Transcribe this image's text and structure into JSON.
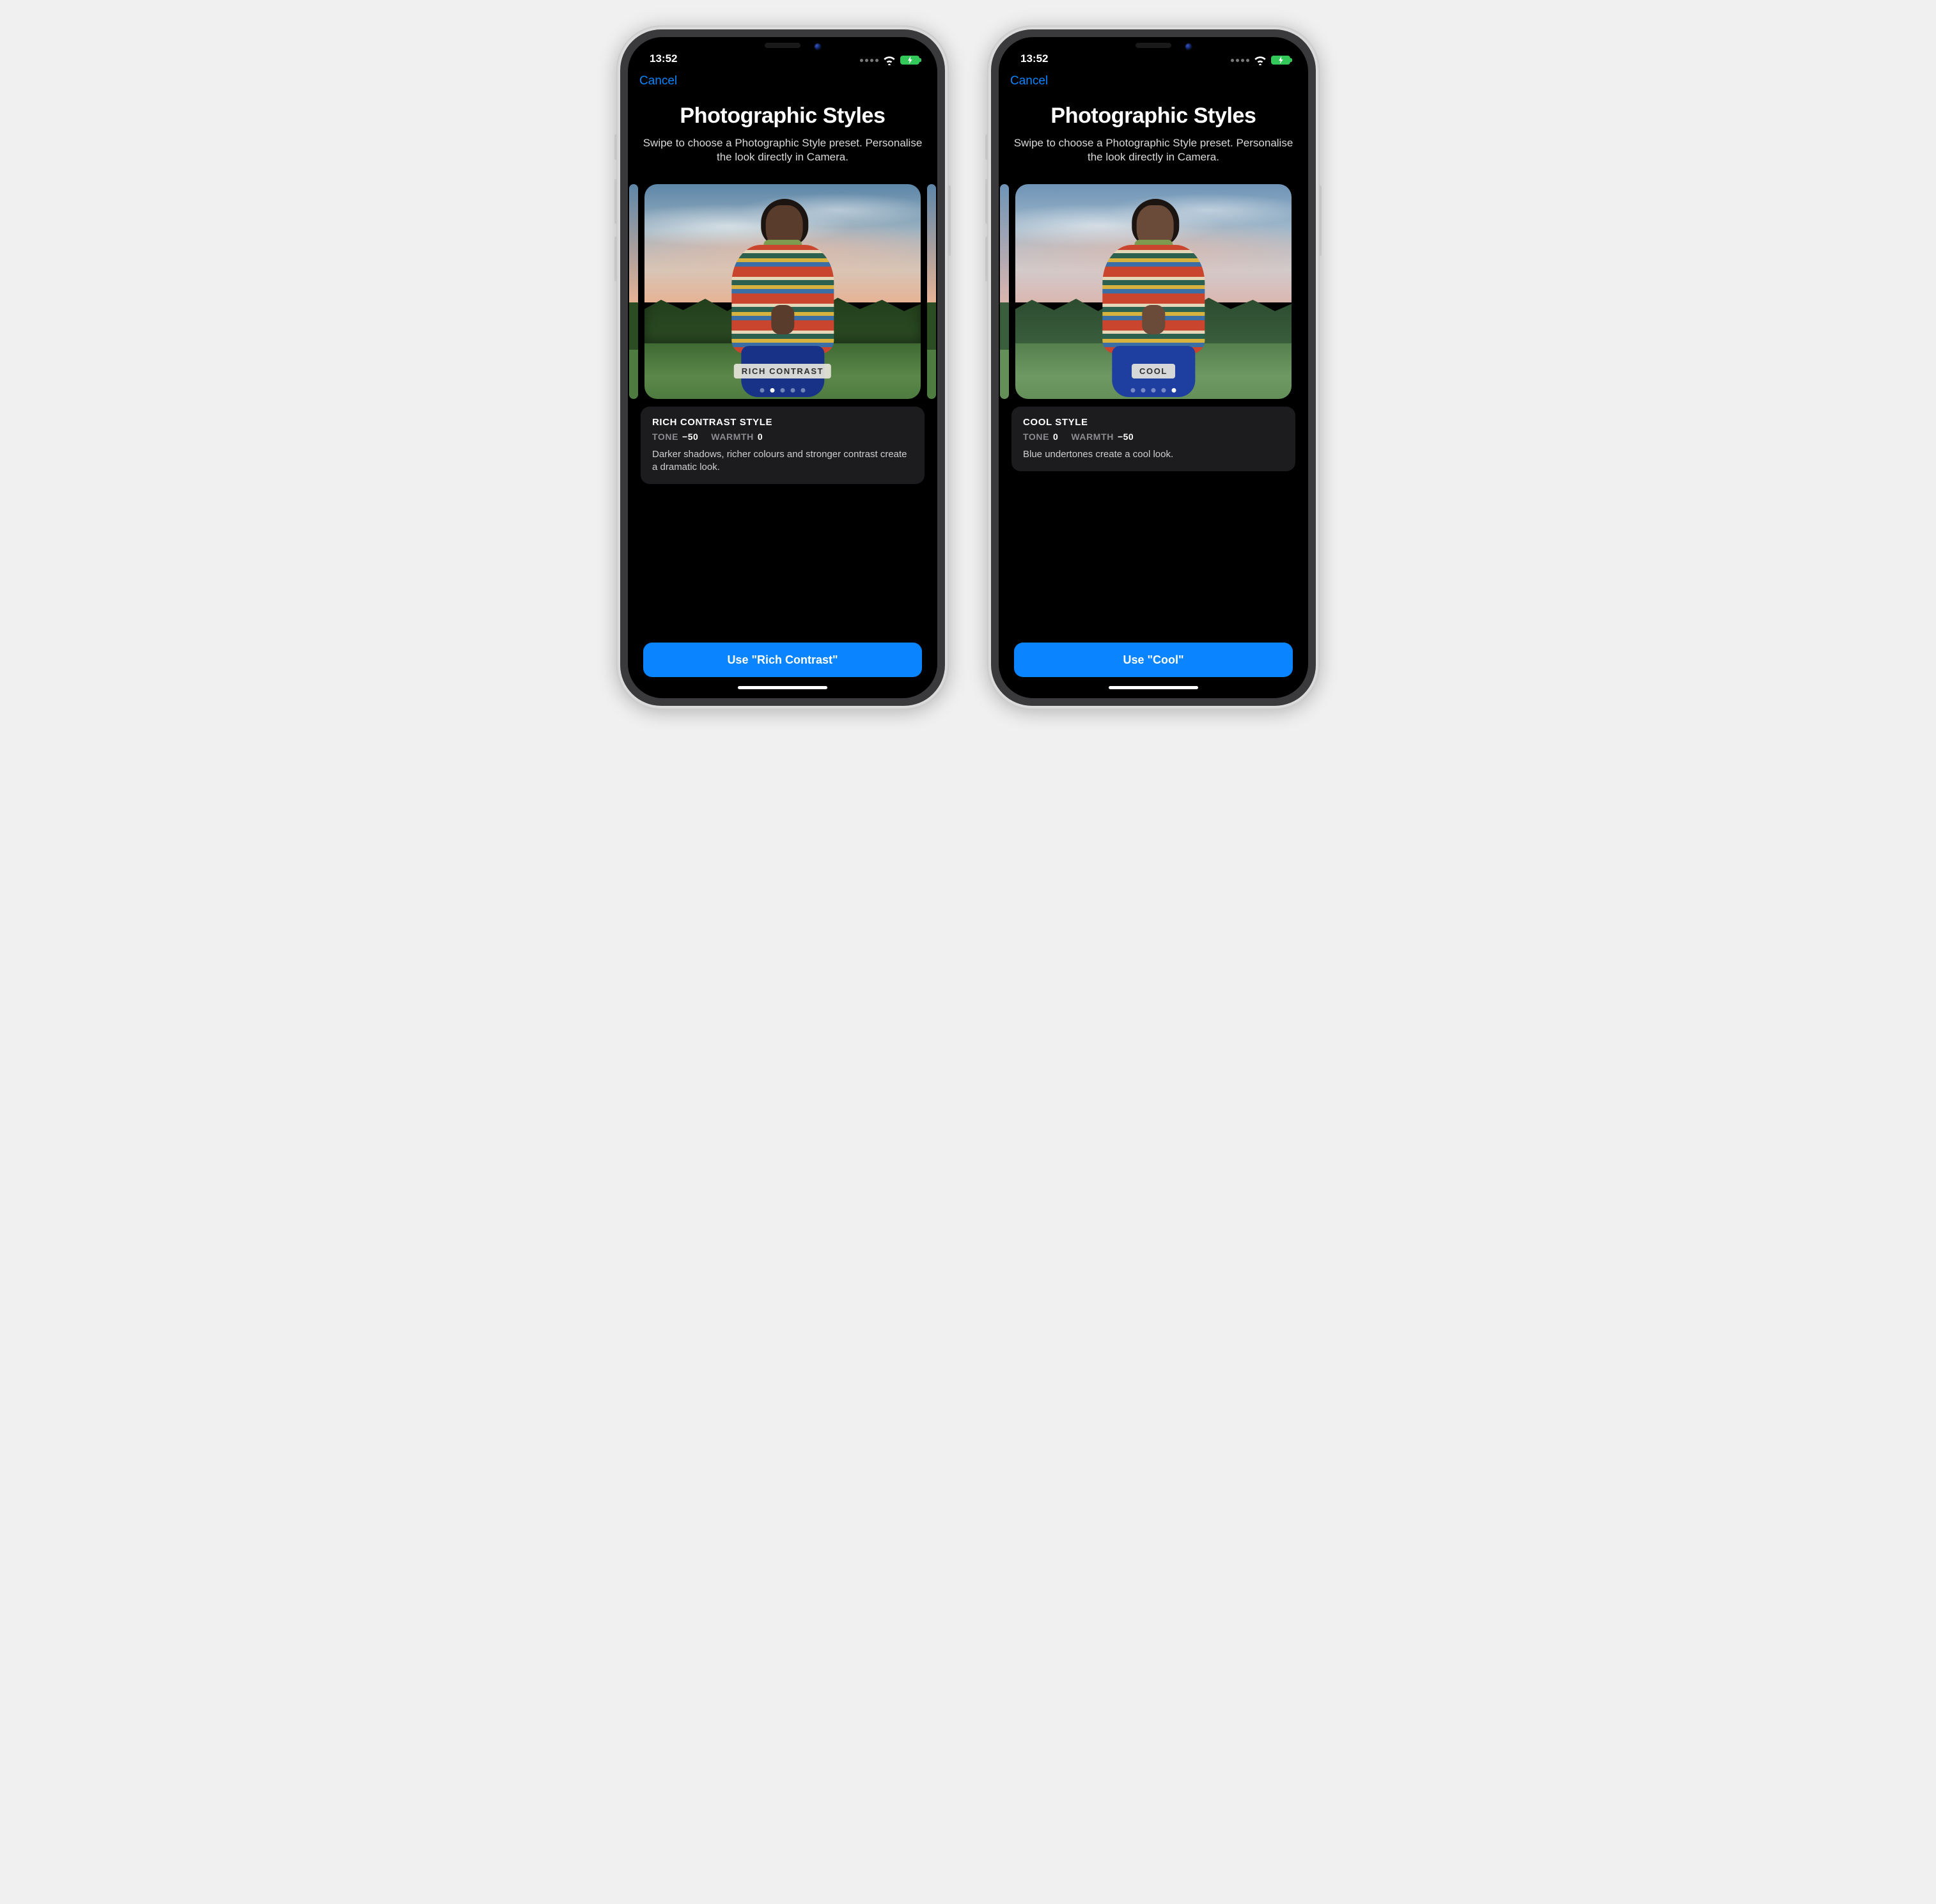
{
  "status": {
    "time": "13:52"
  },
  "nav": {
    "cancel": "Cancel"
  },
  "heading": {
    "title": "Photographic Styles",
    "subtitle": "Swipe to choose a Photographic Style preset. Personalise the look directly in Camera."
  },
  "phones": [
    {
      "badge": "RICH CONTRAST",
      "page_count": 5,
      "page_index": 1,
      "has_right_sliver": true,
      "card": {
        "title": "RICH CONTRAST STYLE",
        "tone_label": "TONE",
        "tone_value": "−50",
        "warmth_label": "WARMTH",
        "warmth_value": "0",
        "description": "Darker shadows, richer colours and stronger contrast create a dramatic look."
      },
      "button": "Use \"Rich Contrast\""
    },
    {
      "badge": "COOL",
      "page_count": 5,
      "page_index": 4,
      "has_right_sliver": false,
      "card": {
        "title": "COOL STYLE",
        "tone_label": "TONE",
        "tone_value": "0",
        "warmth_label": "WARMTH",
        "warmth_value": "−50",
        "description": "Blue undertones create a cool look."
      },
      "button": "Use \"Cool\""
    }
  ]
}
